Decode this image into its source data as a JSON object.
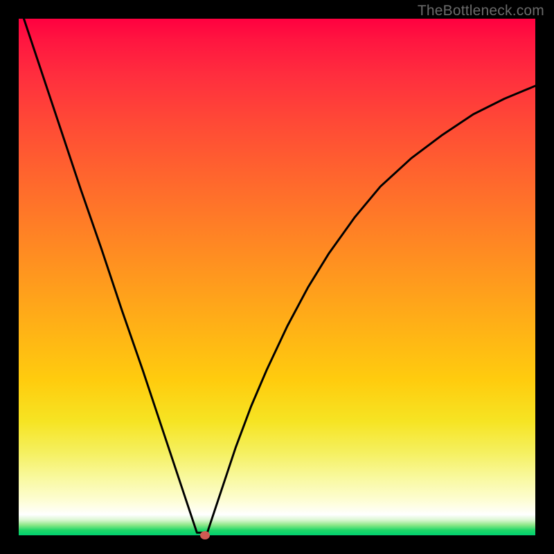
{
  "watermark": {
    "text": "TheBottleneck.com"
  },
  "chart_data": {
    "type": "line",
    "title": "",
    "xlabel": "",
    "ylabel": "",
    "xlim": [
      0,
      100
    ],
    "ylim": [
      0,
      100
    ],
    "grid": false,
    "curve_points": [
      {
        "x": 1.0,
        "y": 100.0
      },
      {
        "x": 3.0,
        "y": 94.0
      },
      {
        "x": 5.0,
        "y": 88.0
      },
      {
        "x": 8.0,
        "y": 79.0
      },
      {
        "x": 12.0,
        "y": 67.0
      },
      {
        "x": 16.0,
        "y": 55.5
      },
      {
        "x": 20.0,
        "y": 43.5
      },
      {
        "x": 24.0,
        "y": 32.0
      },
      {
        "x": 28.0,
        "y": 20.0
      },
      {
        "x": 31.0,
        "y": 11.0
      },
      {
        "x": 33.0,
        "y": 5.0
      },
      {
        "x": 34.0,
        "y": 2.0
      },
      {
        "x": 34.5,
        "y": 0.5
      },
      {
        "x": 36.5,
        "y": 0.5
      },
      {
        "x": 37.0,
        "y": 2.0
      },
      {
        "x": 38.0,
        "y": 5.0
      },
      {
        "x": 40.0,
        "y": 11.0
      },
      {
        "x": 42.0,
        "y": 17.0
      },
      {
        "x": 45.0,
        "y": 25.0
      },
      {
        "x": 48.0,
        "y": 32.0
      },
      {
        "x": 52.0,
        "y": 40.5
      },
      {
        "x": 56.0,
        "y": 48.0
      },
      {
        "x": 60.0,
        "y": 54.5
      },
      {
        "x": 65.0,
        "y": 61.5
      },
      {
        "x": 70.0,
        "y": 67.5
      },
      {
        "x": 76.0,
        "y": 73.0
      },
      {
        "x": 82.0,
        "y": 77.5
      },
      {
        "x": 88.0,
        "y": 81.5
      },
      {
        "x": 94.0,
        "y": 84.5
      },
      {
        "x": 100.0,
        "y": 87.0
      }
    ],
    "minimum_marker": {
      "x": 36.0,
      "y": 0.0,
      "color": "#cf5a53"
    },
    "curve_color": "#000000",
    "curve_width": 3
  }
}
